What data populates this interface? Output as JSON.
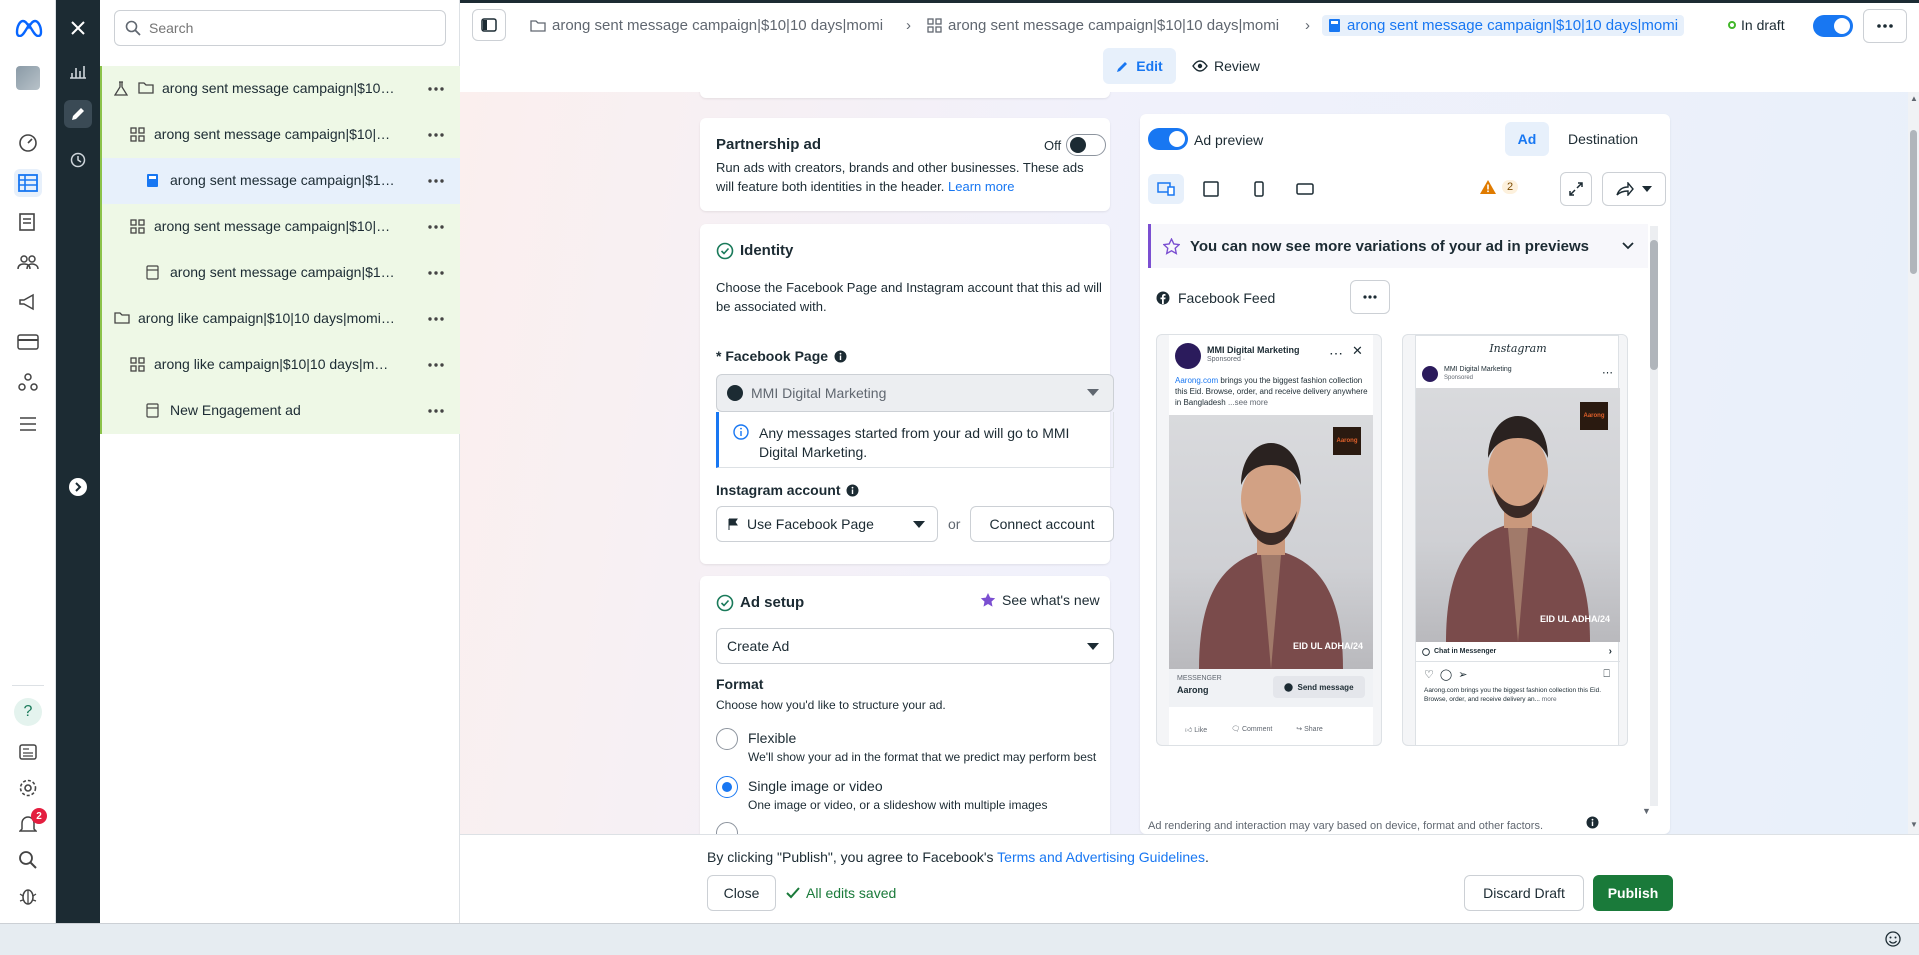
{
  "search": {
    "placeholder": "Search"
  },
  "tree": [
    {
      "label": "arong sent message campaign|$10|1...",
      "icon": "folder-icon",
      "extra": "flask-icon"
    },
    {
      "label": "arong sent message campaign|$10|10 ...",
      "icon": "grid-icon"
    },
    {
      "label": "arong sent message campaign|$10|...",
      "icon": "ad-filled-icon",
      "selected": true
    },
    {
      "label": "arong sent message campaign|$10|10 ...",
      "icon": "grid-icon"
    },
    {
      "label": "arong sent message campaign|$10|...",
      "icon": "ad-icon"
    },
    {
      "label": "arong like campaign|$10|10 days|momin...",
      "icon": "folder-icon"
    },
    {
      "label": "arong like campaign|$10|10 days|mom...",
      "icon": "grid-icon"
    },
    {
      "label": "New Engagement ad",
      "icon": "ad-icon"
    }
  ],
  "breadcrumb": {
    "c1": "arong sent message campaign|$10|10 days|momi",
    "c2": "arong sent message campaign|$10|10 days|momi",
    "c3": "arong sent message campaign|$10|10 days|momi",
    "status": "In draft"
  },
  "modes": {
    "edit": "Edit",
    "review": "Review"
  },
  "partnership": {
    "title": "Partnership ad",
    "toggle_label": "Off",
    "desc": "Run ads with creators, brands and other businesses. These ads will feature both identities in the header.",
    "learn_more": "Learn more"
  },
  "identity": {
    "title": "Identity",
    "desc": "Choose the Facebook Page and Instagram account that this ad will be associated with.",
    "fb_label": "* Facebook Page",
    "fb_value": "MMI Digital Marketing",
    "info": "Any messages started from your ad will go to MMI Digital Marketing.",
    "ig_label": "Instagram account",
    "ig_value": "Use Facebook Page",
    "or": "or",
    "connect": "Connect account"
  },
  "adsetup": {
    "title": "Ad setup",
    "whats_new": "See what's new",
    "create": "Create Ad",
    "format_title": "Format",
    "format_desc": "Choose how you'd like to structure your ad.",
    "options": [
      {
        "label": "Flexible",
        "desc": "We'll show your ad in the format that we predict may perform best",
        "selected": false
      },
      {
        "label": "Single image or video",
        "desc": "One image or video, or a slideshow with multiple images",
        "selected": true
      }
    ]
  },
  "preview": {
    "toggle_label": "Ad preview",
    "tab_ad": "Ad",
    "tab_dest": "Destination",
    "warn_count": "2",
    "banner": "You can now see more variations of your ad in previews",
    "placement": "Facebook Feed",
    "disclaimer": "Ad rendering and interaction may vary based on device, format and other factors.",
    "fb": {
      "page": "MMI Digital Marketing",
      "sponsored": "Sponsored · ",
      "caption_link": "Aarong.com",
      "caption": " brings you the biggest fashion collection this Eid. Browse, order, and receive delivery anywhere in Bangladesh",
      "see_more": "...see more",
      "overlay": "EID UL ADHA/24",
      "cta_top": "MESSENGER",
      "cta_name": "Aarong",
      "cta_button": "Send message",
      "like": "Like",
      "comment": "Comment",
      "share": "Share",
      "logo": "Aarong"
    },
    "ig": {
      "brand": "Instagram",
      "page": "MMI Digital Marketing",
      "sponsored": "Sponsored",
      "overlay": "EID UL ADHA/24",
      "cta": "Chat in Messenger",
      "caption": "Aarong.com brings you the biggest fashion collection this Eid. Browse, order, and receive delivery an...",
      "more": "more",
      "logo": "Aarong"
    }
  },
  "footer": {
    "terms_prefix": "By clicking \"Publish\", you agree to Facebook's ",
    "terms_link": "Terms and Advertising Guidelines",
    "terms_suffix": ".",
    "close": "Close",
    "saved": "All edits saved",
    "discard": "Discard Draft",
    "publish": "Publish"
  },
  "rail": {
    "notif_count": "2"
  },
  "colors": {
    "accent": "#1877f2",
    "publish": "#1a7a3a",
    "rail_dark": "#1c2b33"
  }
}
